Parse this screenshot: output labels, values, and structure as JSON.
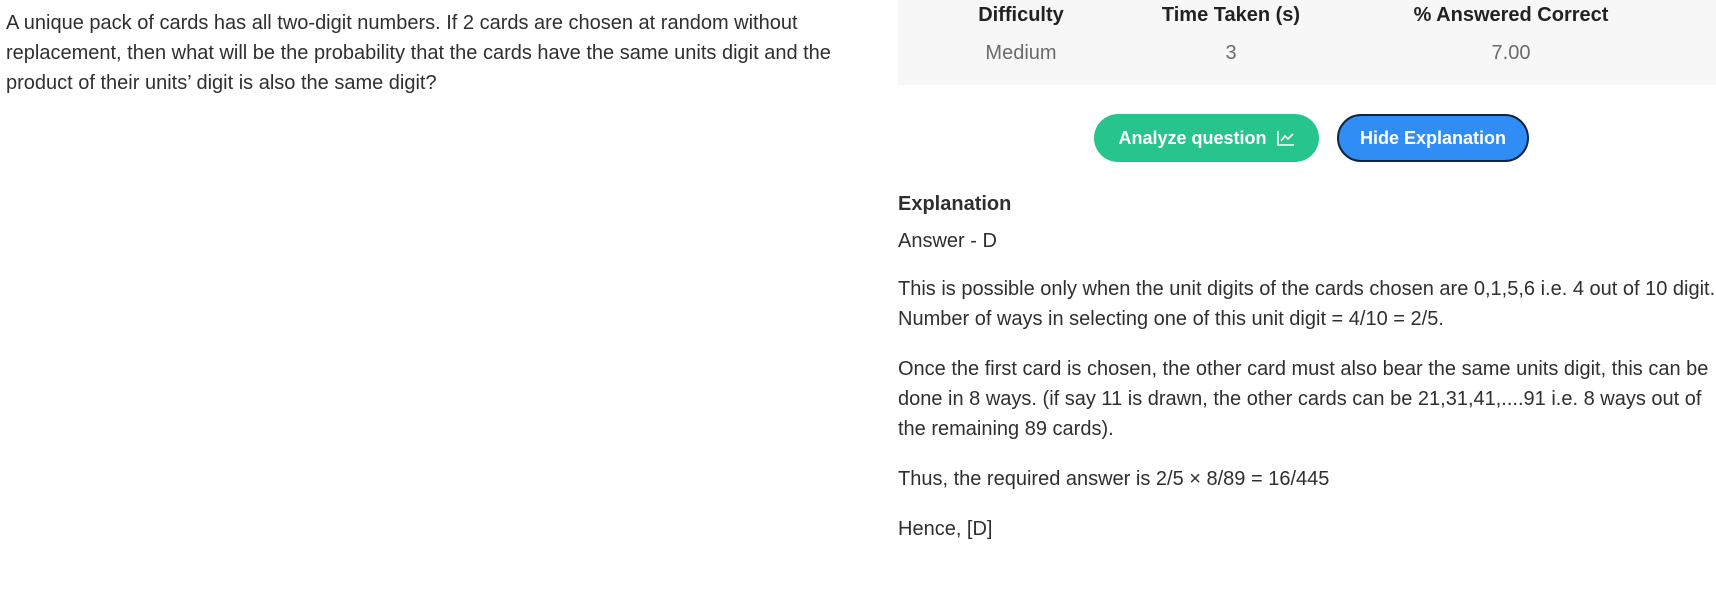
{
  "question": {
    "text": "A unique pack of cards has all two-digit numbers. If 2 cards are chosen at random without replacement, then what will be the probability that the cards have the same units digit and the product of their units’ digit is also the same digit?"
  },
  "stats": {
    "difficulty_label": "Difficulty",
    "difficulty_value": "Medium",
    "time_label": "Time Taken (s)",
    "time_value": "3",
    "correct_label": "% Answered Correct",
    "correct_value": "7.00"
  },
  "buttons": {
    "analyze_label": "Analyze question",
    "analyze_icon": "chart-icon",
    "hide_label": "Hide Explanation",
    "analyze_color": "#27c48c",
    "hide_color": "#2f8df5"
  },
  "explanation": {
    "heading": "Explanation",
    "answer": "Answer - D",
    "para1": "This is possible only when the unit digits of the cards chosen are 0,1,5,6 i.e. 4 out of 10 digit. Number of ways in selecting one of this unit digit = 4/10 = 2/5.",
    "para2": "Once the first card is chosen, the other card must also bear the same units digit, this can be done in 8 ways. (if say 11 is drawn, the other cards can be 21,31,41,....91 i.e. 8 ways out of the remaining 89 cards).",
    "para3": "Thus, the required answer is 2/5 × 8/89 = 16/445",
    "para4": "Hence, [D]"
  }
}
